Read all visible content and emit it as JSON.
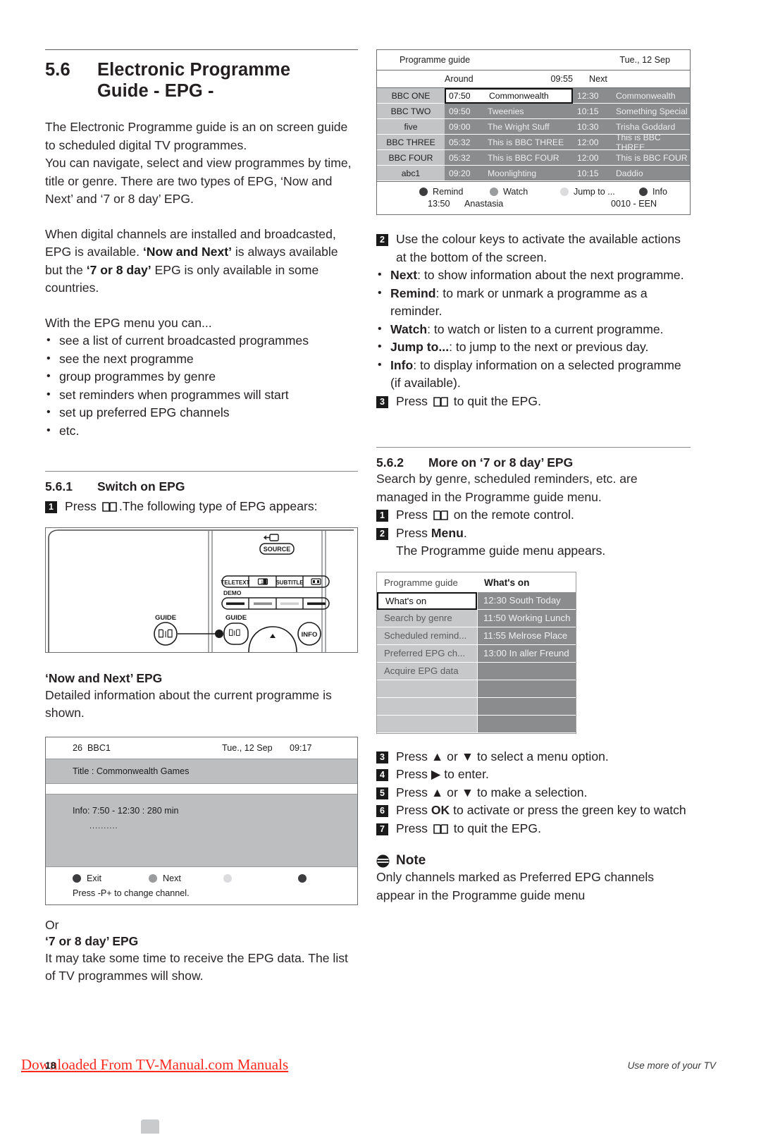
{
  "section": {
    "number": "5.6",
    "title_line1": "Electronic Programme",
    "title_line2": "Guide - EPG -"
  },
  "left": {
    "intro1": "The Electronic Programme guide is an on screen guide to scheduled digital TV programmes.",
    "intro2": "You can navigate, select and view programmes by time, title or genre. There are two types of EPG, ‘Now and Next’ and ‘7 or 8 day’ EPG.",
    "intro3_a": "When digital channels are installed and broadcasted, EPG is available. ",
    "intro3_b": "‘Now and Next’",
    "intro3_c": " is always available but the ",
    "intro3_d": "‘7 or 8 day’",
    "intro3_e": " EPG is only available in some countries.",
    "menu_lead": "With the EPG menu you can...",
    "menu_items": [
      "see a list of current broadcasted programmes",
      "see the next programme",
      "group programmes by genre",
      "set reminders when programmes will start",
      "set up preferred EPG channels",
      "etc."
    ],
    "sub1": {
      "number": "5.6.1",
      "title": "Switch on EPG"
    },
    "step1_a": "Press ",
    "step1_b": ".The following type of EPG appears:",
    "nn_heading": "‘Now and Next’ EPG",
    "nn_text": "Detailed information about the current programme is shown.",
    "or_text": "Or",
    "day7_heading": "‘7 or 8 day’ EPG",
    "day7_text": "It may take some time to receive the EPG data. The list of TV programmes will show."
  },
  "remote": {
    "source_label": "SOURCE",
    "source_icon": "source-arrow-icon",
    "teletext_label": "TELETEXT",
    "subtitle_label": "SUBTITLE",
    "demo_label": "DEMO",
    "guide_label_left": "GUIDE",
    "guide_label_right": "GUIDE",
    "info_label": "INFO"
  },
  "now_next_screen": {
    "channel_number": "26",
    "channel_name": "BBC1",
    "date": "Tue., 12 Sep",
    "time": "09:17",
    "title_line": "Title : Commonwealth Games",
    "info_line": "Info: 7:50 - 12:30 : 280 min",
    "info_dots": "..........",
    "keys": [
      {
        "label": "Exit",
        "color": "dot-dark"
      },
      {
        "label": "Next",
        "color": "dot-mid"
      },
      {
        "label": "",
        "color": "dot-light"
      },
      {
        "label": "",
        "color": "dot-dark"
      }
    ],
    "footer_note": "Press -P+ to change channel."
  },
  "epg_screen": {
    "title": "Programme guide",
    "date": "Tue., 12 Sep",
    "col_around": "Around",
    "col_time": "09:55",
    "col_next": "Next",
    "rows": [
      {
        "channel": "BBC ONE",
        "now_time": "07:50",
        "now_title": "Commonwealth",
        "next_time": "12:30",
        "next_title": "Commonwealth",
        "selected": true
      },
      {
        "channel": "BBC TWO",
        "now_time": "09:50",
        "now_title": "Tweenies",
        "next_time": "10:15",
        "next_title": "Something Special",
        "selected": false
      },
      {
        "channel": "five",
        "now_time": "09:00",
        "now_title": "The Wright Stuff",
        "next_time": "10:30",
        "next_title": "Trisha Goddard",
        "selected": false
      },
      {
        "channel": "BBC THREE",
        "now_time": "05:32",
        "now_title": "This is BBC THREE",
        "next_time": "12:00",
        "next_title": "This is BBC THREE",
        "selected": false
      },
      {
        "channel": "BBC FOUR",
        "now_time": "05:32",
        "now_title": "This is BBC FOUR",
        "next_time": "12:00",
        "next_title": "This is BBC FOUR",
        "selected": false
      },
      {
        "channel": "abc1",
        "now_time": "09:20",
        "now_title": "Moonlighting",
        "next_time": "10:15",
        "next_title": "Daddio",
        "selected": false
      }
    ],
    "keys": [
      {
        "label": "Remind",
        "color": "dot-dark"
      },
      {
        "label": "Watch",
        "color": "dot-mid"
      },
      {
        "label": "Jump to ...",
        "color": "dot-light"
      },
      {
        "label": "Info",
        "color": "dot-dark"
      }
    ],
    "status_time": "13:50",
    "status_title": "Anastasia",
    "status_right": "0010 - EEN"
  },
  "right": {
    "step2_text": "Use the colour keys to activate the available actions at the bottom of the screen.",
    "colour_keys": [
      {
        "name": "Next",
        "desc": ": to show information about the next programme."
      },
      {
        "name": "Remind",
        "desc": ": to mark or unmark a programme as a reminder."
      },
      {
        "name": "Watch",
        "desc": ": to watch or listen to a current programme."
      },
      {
        "name": "Jump to...",
        "desc": ": to jump to the next or previous day."
      },
      {
        "name": "Info",
        "desc": ": to display information on a selected programme (if available)."
      }
    ],
    "step3_a": "Press ",
    "step3_b": " to quit the EPG.",
    "sub2": {
      "number": "5.6.2",
      "title": "More on ‘7 or 8 day’ EPG"
    },
    "sub2_text": "Search by genre, scheduled reminders, etc. are managed in the Programme guide menu.",
    "step_r1_a": "Press ",
    "step_r1_b": " on the remote control.",
    "step_r2_a": "Press ",
    "step_r2_b": "Menu",
    "step_r2_c": ".",
    "step_r2_sub": "The Programme guide menu appears.",
    "step_r3": "Press ▲ or ▼ to select a menu option.",
    "step_r4": "Press ▶ to enter.",
    "step_r5": "Press ▲ or ▼ to make a selection.",
    "step_r6_a": "Press ",
    "step_r6_b": "OK",
    "step_r6_c": " to activate or press the green key to watch",
    "step_r7_a": "Press ",
    "step_r7_b": " to quit the EPG.",
    "note_title": "Note",
    "note_text": "Only channels marked as Preferred EPG channels appear in the Programme guide menu"
  },
  "pg_menu": {
    "header_left": "Programme guide",
    "header_right": "What's on",
    "rows": [
      {
        "left": "What's on",
        "right": "12:30 South Today",
        "selected": true,
        "empty": false
      },
      {
        "left": "Search by genre",
        "right": "11:50 Working Lunch",
        "selected": false,
        "empty": false
      },
      {
        "left": "Scheduled remind...",
        "right": "11:55 Melrose Place",
        "selected": false,
        "empty": false
      },
      {
        "left": "Preferred EPG ch...",
        "right": "13:00 In aller Freund",
        "selected": false,
        "empty": false
      },
      {
        "left": "Acquire EPG data",
        "right": "",
        "selected": false,
        "empty": false
      },
      {
        "left": "",
        "right": "",
        "selected": false,
        "empty": true
      },
      {
        "left": "",
        "right": "",
        "selected": false,
        "empty": true
      },
      {
        "left": "",
        "right": "",
        "selected": false,
        "empty": true
      }
    ]
  },
  "footer": {
    "watermark": "Downloaded From TV-Manual.com Manuals",
    "page_number": "18",
    "right_text": "Use more of your TV"
  }
}
